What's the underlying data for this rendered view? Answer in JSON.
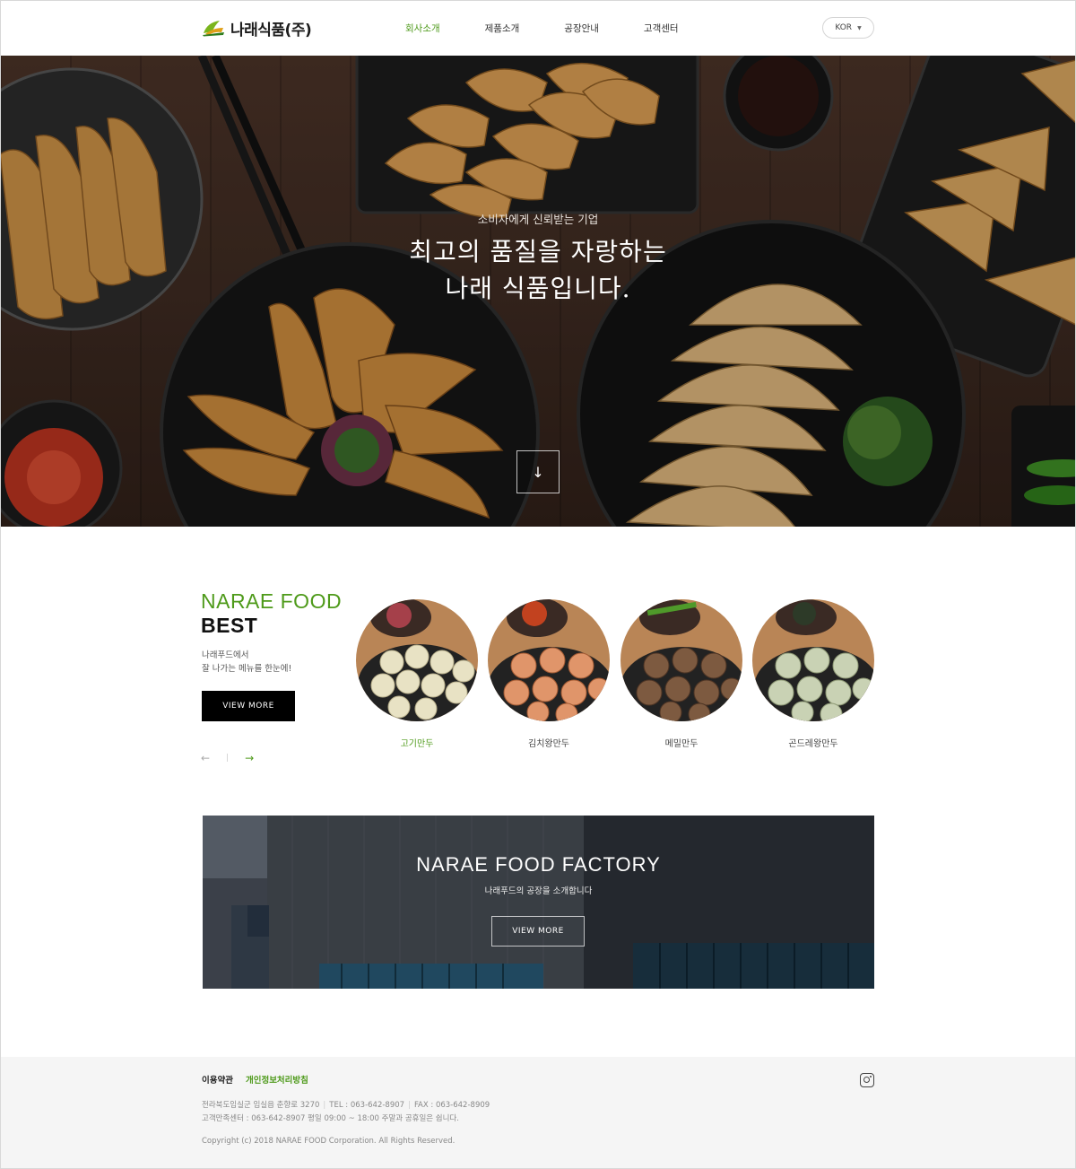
{
  "header": {
    "brand": "나래식품(주)",
    "nav": [
      {
        "label": "회사소개",
        "active": true
      },
      {
        "label": "제품소개",
        "active": false
      },
      {
        "label": "공장안내",
        "active": false
      },
      {
        "label": "고객센터",
        "active": false
      }
    ],
    "language": "KOR"
  },
  "hero": {
    "subtitle": "소비자에게 신뢰받는 기업",
    "title_line1": "최고의 품질을 자랑하는",
    "title_line2": "나래 식품입니다.",
    "scroll_icon": "arrow-down-icon"
  },
  "best": {
    "title_a": "NARAE FOOD",
    "title_b": "BEST",
    "desc_line1": "나래푸드에서",
    "desc_line2": "잘 나가는 메뉴를 한눈에!",
    "button": "VIEW MORE",
    "prev_arrow": "←",
    "next_arrow": "→",
    "separator": "|",
    "products": [
      {
        "name": "고기만두",
        "active": true
      },
      {
        "name": "김치왕만두",
        "active": false
      },
      {
        "name": "메밀만두",
        "active": false
      },
      {
        "name": "곤드레왕만두",
        "active": false
      }
    ]
  },
  "factory": {
    "title": "NARAE FOOD FACTORY",
    "subtitle": "나래푸드의 공장을 소개합니다",
    "button": "VIEW MORE"
  },
  "footer": {
    "terms": "이용약관",
    "privacy": "개인정보처리방침",
    "address": "전라북도임실군 임실읍 춘향로 3270",
    "tel": "TEL : 063-642-8907",
    "fax": "FAX : 063-642-8909",
    "service": "고객만족센터 : 063-642-8907 평일 09:00 ~ 18:00 주말과 공휴일은 쉽니다.",
    "copyright": "Copyright (c) 2018 NARAE FOOD Corporation. All Rights Reserved."
  },
  "colors": {
    "accent": "#4e9a1a",
    "button_dark": "#000000",
    "footer_bg": "#f5f5f5"
  }
}
